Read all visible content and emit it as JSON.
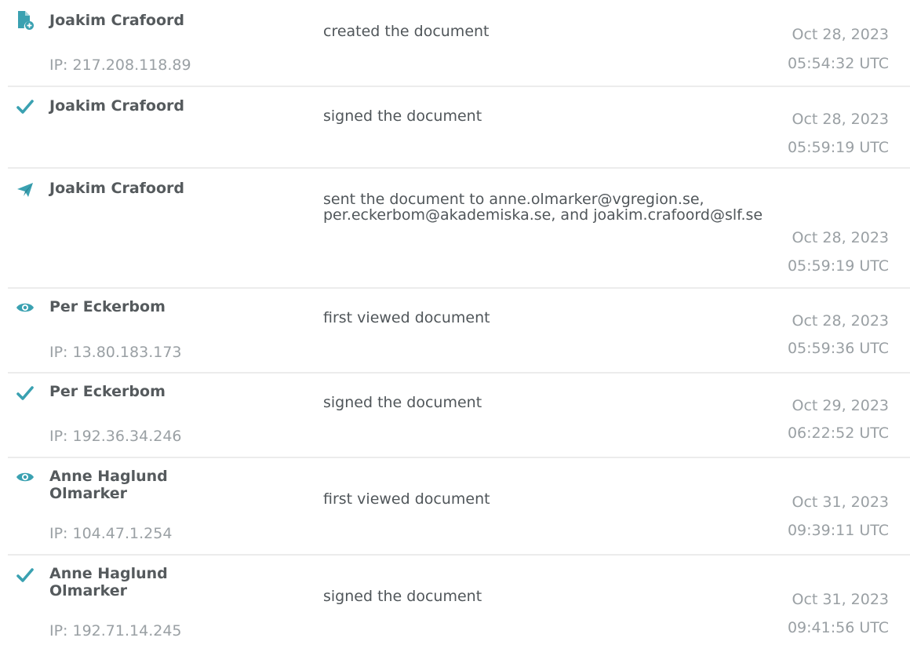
{
  "colors": {
    "icon": "#3aa1b1",
    "actor": "#555a5d",
    "muted": "#9aa0a4",
    "action": "#50565a",
    "divider": "#ececec"
  },
  "events": [
    {
      "icon": "document-add-icon",
      "actor": "Joakim Crafoord",
      "ip": "IP: 217.208.118.89",
      "action": "created the document",
      "date": "Oct 28, 2023",
      "time": "05:54:32 UTC"
    },
    {
      "icon": "checkmark-icon",
      "actor": "Joakim Crafoord",
      "ip": "",
      "action": "signed the document",
      "date": "Oct 28, 2023",
      "time": "05:59:19 UTC"
    },
    {
      "icon": "paper-plane-icon",
      "actor": "Joakim Crafoord",
      "ip": "",
      "action": "sent the document to anne.olmarker@vgregion.se, per.eckerbom@akademiska.se, and joakim.crafoord@slf.se",
      "date": "Oct 28, 2023",
      "time": "05:59:19 UTC"
    },
    {
      "icon": "eye-icon",
      "actor": "Per Eckerbom",
      "ip": "IP: 13.80.183.173",
      "action": "first viewed document",
      "date": "Oct 28, 2023",
      "time": "05:59:36 UTC"
    },
    {
      "icon": "checkmark-icon",
      "actor": "Per Eckerbom",
      "ip": "IP: 192.36.34.246",
      "action": "signed the document",
      "date": "Oct 29, 2023",
      "time": "06:22:52 UTC"
    },
    {
      "icon": "eye-icon",
      "actor": "Anne Haglund Olmarker",
      "ip": "IP: 104.47.1.254",
      "action": "first viewed document",
      "date": "Oct 31, 2023",
      "time": "09:39:11 UTC"
    },
    {
      "icon": "checkmark-icon",
      "actor": "Anne Haglund Olmarker",
      "ip": "IP: 192.71.14.245",
      "action": "signed the document",
      "date": "Oct 31, 2023",
      "time": "09:41:56 UTC"
    }
  ]
}
